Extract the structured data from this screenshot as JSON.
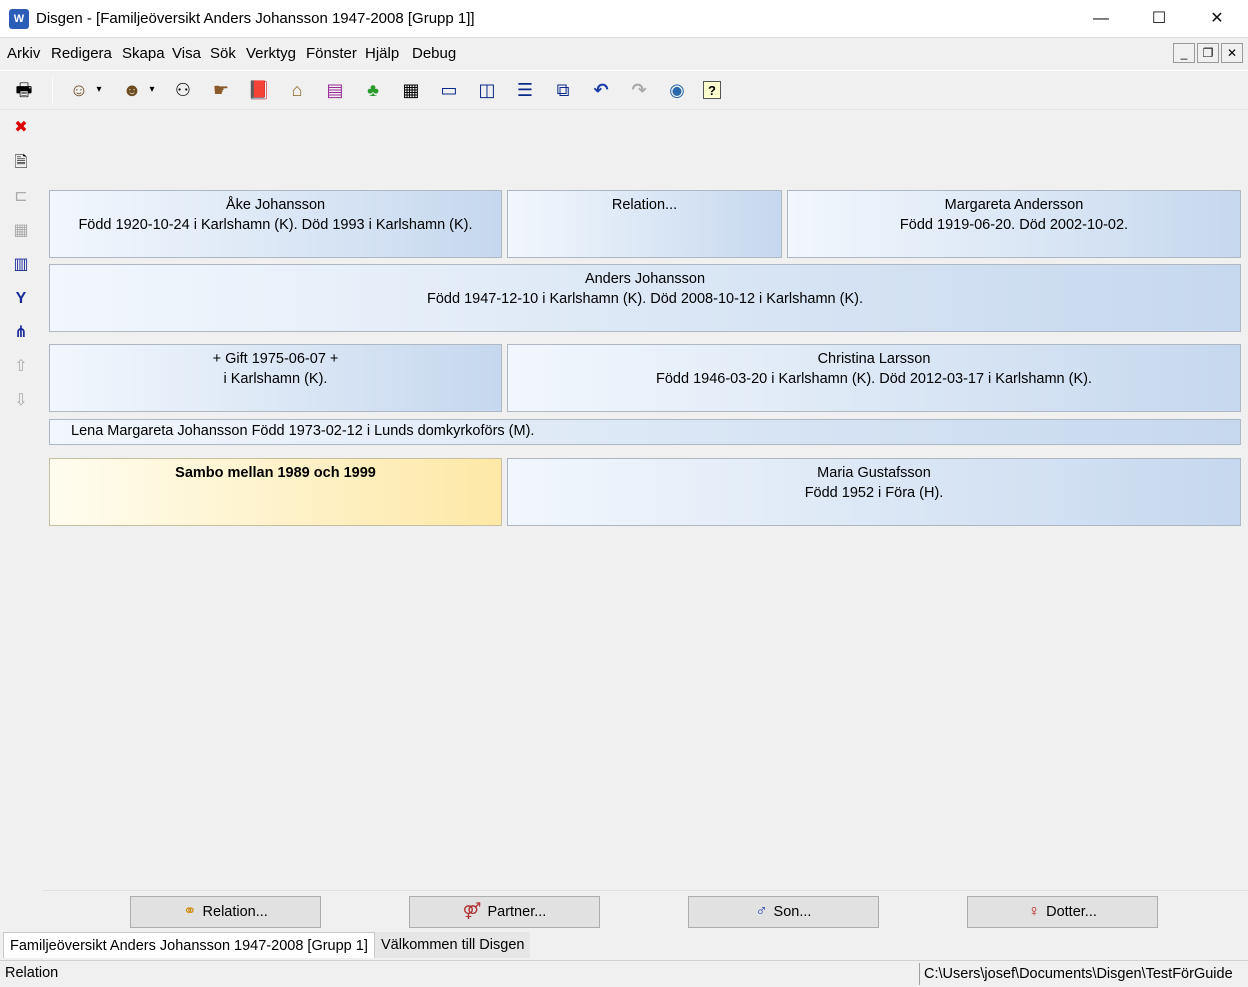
{
  "window": {
    "app_icon_text": "W",
    "title": "Disgen - [Familjeöversikt Anders Johansson 1947-2008 [Grupp 1]]",
    "minimize": "—",
    "maximize": "☐",
    "close": "✕"
  },
  "menu": {
    "items": [
      "Arkiv",
      "Redigera",
      "Skapa",
      "Visa",
      "Sök",
      "Verktyg",
      "Fönster",
      "Hjälp",
      "Debug"
    ],
    "mdi_minimize": "_",
    "mdi_restore": "❐",
    "mdi_close": "✕"
  },
  "toolbar": {
    "icons": [
      {
        "name": "print-icon",
        "glyph": "🖶"
      },
      {
        "name": "person-icon",
        "glyph": "☺"
      },
      {
        "name": "person-dropdown-icon",
        "glyph": "▾"
      },
      {
        "name": "search-person-icon",
        "glyph": "☻"
      },
      {
        "name": "search-person-dropdown-icon",
        "glyph": "▾"
      },
      {
        "name": "binoculars-icon",
        "glyph": "⚇"
      },
      {
        "name": "hand-pointer-icon",
        "glyph": "☛"
      },
      {
        "name": "book-icon",
        "glyph": "📕"
      },
      {
        "name": "home-icon",
        "glyph": "⌂"
      },
      {
        "name": "books-icon",
        "glyph": "▤"
      },
      {
        "name": "map-icon",
        "glyph": "♣"
      },
      {
        "name": "calendar-icon",
        "glyph": "▦"
      },
      {
        "name": "window-single-icon",
        "glyph": "▭"
      },
      {
        "name": "window-split-vertical-icon",
        "glyph": "◫"
      },
      {
        "name": "window-split-horizontal-icon",
        "glyph": "☰"
      },
      {
        "name": "window-cascade-icon",
        "glyph": "⧉"
      },
      {
        "name": "undo-icon",
        "glyph": "↶"
      },
      {
        "name": "redo-icon",
        "glyph": "↷"
      },
      {
        "name": "globe-icon",
        "glyph": "◉"
      },
      {
        "name": "help-icon",
        "glyph": "?"
      }
    ]
  },
  "sidebar": {
    "icons": [
      {
        "name": "close-window-icon",
        "glyph": "✖"
      },
      {
        "name": "document-icon",
        "glyph": "🗎"
      },
      {
        "name": "tree-disabled-icon",
        "glyph": "⊏"
      },
      {
        "name": "grid-disabled-icon",
        "glyph": "▦"
      },
      {
        "name": "columns-icon",
        "glyph": "▥"
      },
      {
        "name": "ancestors-icon",
        "glyph": "Y"
      },
      {
        "name": "descendants-icon",
        "glyph": "⋔"
      },
      {
        "name": "up-disabled-icon",
        "glyph": "⇧"
      },
      {
        "name": "down-disabled-icon",
        "glyph": "⇩"
      }
    ]
  },
  "family": {
    "father": {
      "name": "Åke Johansson",
      "details": "Född 1920-10-24 i Karlshamn (K). Död 1993 i Karlshamn (K)."
    },
    "parents_relation": {
      "label": "Relation..."
    },
    "mother": {
      "name": "Margareta Andersson",
      "details": "Född 1919-06-20. Död 2002-10-02."
    },
    "main_person": {
      "name": "Anders Johansson",
      "details": "Född 1947-12-10 i Karlshamn (K). Död 2008-10-12 i Karlshamn (K)."
    },
    "marriage1": {
      "line1": "+ Gift 1975-06-07 +",
      "line2": "i  Karlshamn (K)."
    },
    "partner1": {
      "name": "Christina Larsson",
      "details": "Född 1946-03-20 i Karlshamn (K). Död 2012-03-17 i Karlshamn (K)."
    },
    "child1": {
      "text": "Lena Margareta Johansson Född 1973-02-12 i Lunds domkyrkoförs (M)."
    },
    "relation2": {
      "label": "Sambo mellan 1989 och 1999"
    },
    "partner2": {
      "name": "Maria Gustafsson",
      "details": "Född 1952 i Föra (H)."
    }
  },
  "buttons": {
    "relation": {
      "label": "Relation...",
      "icon": "rings-icon",
      "glyph": "⚭"
    },
    "partner": {
      "label": "Partner...",
      "icon": "couple-icon",
      "glyph": "⚤"
    },
    "son": {
      "label": "Son...",
      "icon": "add-son-icon",
      "glyph": "♂"
    },
    "dotter": {
      "label": "Dotter...",
      "icon": "add-daughter-icon",
      "glyph": "♀"
    }
  },
  "tabs": [
    "Familjeöversikt Anders Johansson 1947-2008 [Grupp 1]",
    "Välkommen till Disgen"
  ],
  "status": {
    "left": "Relation",
    "right": "C:\\Users\\josef\\Documents\\Disgen\\TestFörGuide"
  },
  "colors": {
    "panel_gradient_start": "#f2f7fd",
    "panel_gradient_end": "#c6d8ee",
    "sambo_gradient_start": "#fffdf0",
    "sambo_gradient_end": "#fde8a6"
  }
}
